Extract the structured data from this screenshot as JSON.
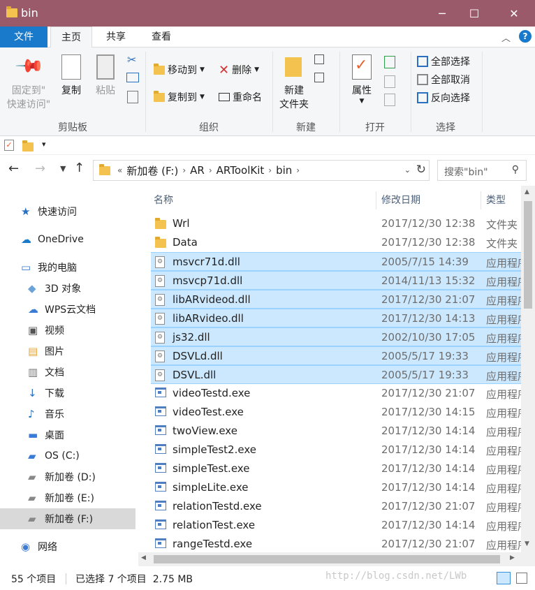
{
  "window": {
    "title": "bin",
    "min": "─",
    "max": "☐",
    "close": "✕"
  },
  "ribbon_tabs": [
    {
      "label": "文件"
    },
    {
      "label": "主页"
    },
    {
      "label": "共享"
    },
    {
      "label": "查看"
    }
  ],
  "ribbon": {
    "clipboard": {
      "pin_line1": "固定到\"",
      "pin_line2": "快速访问\"",
      "copy": "复制",
      "paste": "粘贴",
      "group": "剪贴板"
    },
    "organize": {
      "move_to": "移动到",
      "copy_to": "复制到",
      "delete": "删除",
      "rename": "重命名",
      "group": "组织"
    },
    "new": {
      "new_folder_line1": "新建",
      "new_folder_line2": "文件夹",
      "group": "新建"
    },
    "open": {
      "properties": "属性",
      "group": "打开"
    },
    "select": {
      "select_all": "全部选择",
      "select_none": "全部取消",
      "invert": "反向选择",
      "group": "选择"
    }
  },
  "address": {
    "overflow": "«",
    "crumbs": [
      "新加卷 (F:)",
      "AR",
      "ARToolKit",
      "bin"
    ],
    "search_placeholder": "搜索\"bin\""
  },
  "nav": [
    {
      "label": "快速访问",
      "icon": "star-icon",
      "indent": 0
    },
    {
      "label": "OneDrive",
      "icon": "cloud-icon",
      "indent": 0
    },
    {
      "label": "我的电脑",
      "icon": "computer-icon",
      "indent": 0
    },
    {
      "label": "3D 对象",
      "icon": "3d-objects-icon",
      "indent": 1
    },
    {
      "label": "WPS云文档",
      "icon": "wps-cloud-icon",
      "indent": 1
    },
    {
      "label": "视频",
      "icon": "video-icon",
      "indent": 1
    },
    {
      "label": "图片",
      "icon": "pictures-icon",
      "indent": 1
    },
    {
      "label": "文档",
      "icon": "documents-icon",
      "indent": 1
    },
    {
      "label": "下载",
      "icon": "downloads-icon",
      "indent": 1
    },
    {
      "label": "音乐",
      "icon": "music-icon",
      "indent": 1
    },
    {
      "label": "桌面",
      "icon": "desktop-icon",
      "indent": 1
    },
    {
      "label": "OS (C:)",
      "icon": "drive-c-icon",
      "indent": 1
    },
    {
      "label": "新加卷 (D:)",
      "icon": "drive-icon",
      "indent": 1
    },
    {
      "label": "新加卷 (E:)",
      "icon": "drive-icon",
      "indent": 1
    },
    {
      "label": "新加卷 (F:)",
      "icon": "drive-icon",
      "indent": 1,
      "selected": true
    },
    {
      "label": "网络",
      "icon": "network-icon",
      "indent": 0
    }
  ],
  "columns": {
    "name": "名称",
    "date": "修改日期",
    "type": "类型"
  },
  "files": [
    {
      "name": "Wrl",
      "date": "2017/12/30 12:38",
      "type": "文件夹",
      "kind": "folder",
      "selected": false
    },
    {
      "name": "Data",
      "date": "2017/12/30 12:38",
      "type": "文件夹",
      "kind": "folder",
      "selected": false
    },
    {
      "name": "msvcr71d.dll",
      "date": "2005/7/15 14:39",
      "type": "应用程序扩展",
      "kind": "dll",
      "selected": true
    },
    {
      "name": "msvcp71d.dll",
      "date": "2014/11/13 15:32",
      "type": "应用程序扩展",
      "kind": "dll",
      "selected": true
    },
    {
      "name": "libARvideod.dll",
      "date": "2017/12/30 21:07",
      "type": "应用程序扩展",
      "kind": "dll",
      "selected": true
    },
    {
      "name": "libARvideo.dll",
      "date": "2017/12/30 14:13",
      "type": "应用程序扩展",
      "kind": "dll",
      "selected": true
    },
    {
      "name": "js32.dll",
      "date": "2002/10/30 17:05",
      "type": "应用程序扩展",
      "kind": "dll",
      "selected": true
    },
    {
      "name": "DSVLd.dll",
      "date": "2005/5/17 19:33",
      "type": "应用程序扩展",
      "kind": "dll",
      "selected": true
    },
    {
      "name": "DSVL.dll",
      "date": "2005/5/17 19:33",
      "type": "应用程序扩展",
      "kind": "dll",
      "selected": true
    },
    {
      "name": "videoTestd.exe",
      "date": "2017/12/30 21:07",
      "type": "应用程序",
      "kind": "exe",
      "selected": false
    },
    {
      "name": "videoTest.exe",
      "date": "2017/12/30 14:15",
      "type": "应用程序",
      "kind": "exe",
      "selected": false
    },
    {
      "name": "twoView.exe",
      "date": "2017/12/30 14:14",
      "type": "应用程序",
      "kind": "exe",
      "selected": false
    },
    {
      "name": "simpleTest2.exe",
      "date": "2017/12/30 14:14",
      "type": "应用程序",
      "kind": "exe",
      "selected": false
    },
    {
      "name": "simpleTest.exe",
      "date": "2017/12/30 14:14",
      "type": "应用程序",
      "kind": "exe",
      "selected": false
    },
    {
      "name": "simpleLite.exe",
      "date": "2017/12/30 14:14",
      "type": "应用程序",
      "kind": "exe",
      "selected": false
    },
    {
      "name": "relationTestd.exe",
      "date": "2017/12/30 21:07",
      "type": "应用程序",
      "kind": "exe",
      "selected": false
    },
    {
      "name": "relationTest.exe",
      "date": "2017/12/30 14:14",
      "type": "应用程序",
      "kind": "exe",
      "selected": false
    },
    {
      "name": "rangeTestd.exe",
      "date": "2017/12/30 21:07",
      "type": "应用程序",
      "kind": "exe",
      "selected": false
    }
  ],
  "status": {
    "count": "55 个项目",
    "selection": "已选择 7 个项目  2.75 MB",
    "watermark": "http://blog.csdn.net/LWb"
  },
  "colors": {
    "titlebar": "#9b5a6a",
    "file_tab": "#1979ca",
    "selection": "#cce8ff"
  }
}
